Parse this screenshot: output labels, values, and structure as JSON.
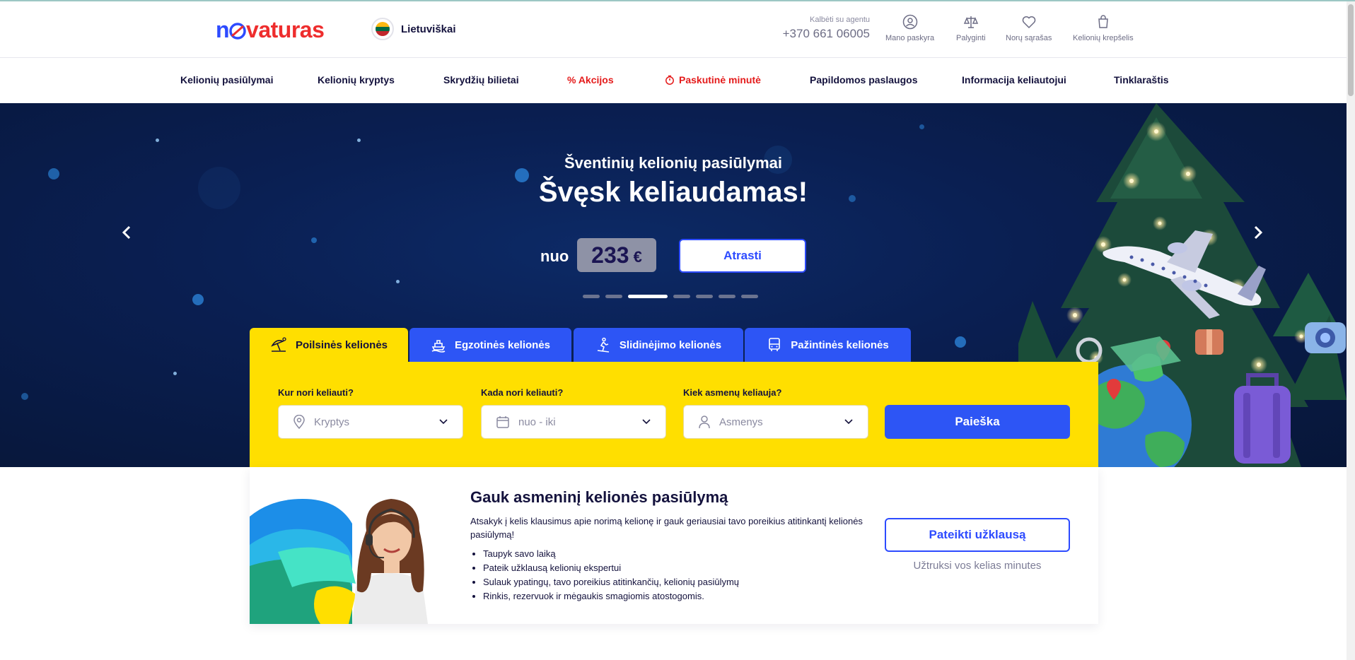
{
  "header": {
    "logo_part1": "n",
    "logo_part2": "va",
    "logo_part3": "turas",
    "language": "Lietuviškai",
    "agent_label": "Kalbėti su agentu",
    "agent_phone": "+370 661 06005",
    "account": "Mano paskyra",
    "compare": "Palyginti",
    "wishlist": "Norų sąrašas",
    "cart": "Kelionių krepšelis"
  },
  "nav": {
    "items": [
      "Kelionių pasiūlymai",
      "Kelionių kryptys",
      "Skrydžių bilietai",
      "% Akcijos",
      "Paskutinė minutė",
      "Papildomos paslaugos",
      "Informacija keliautojui",
      "Tinklaraštis"
    ]
  },
  "hero": {
    "subtitle": "Šventinių kelionių pasiūlymai",
    "title": "Švęsk keliaudamas!",
    "from_label": "nuo",
    "price": "233",
    "currency": "€",
    "cta": "Atrasti",
    "slide_count": 7,
    "active_slide": 3
  },
  "tabs": [
    "Poilsinės kelionės",
    "Egzotinės kelionės",
    "Slidinėjimo kelionės",
    "Pažintinės kelionės"
  ],
  "search": {
    "where_label": "Kur nori keliauti?",
    "where_placeholder": "Kryptys",
    "when_label": "Kada nori keliauti?",
    "when_placeholder": "nuo - iki",
    "who_label": "Kiek asmenų keliauja?",
    "who_placeholder": "Asmenys",
    "button": "Paieška"
  },
  "offer": {
    "title": "Gauk asmeninį kelionės pasiūlymą",
    "description": "Atsakyk į kelis klausimus apie norimą kelionę ir gauk geriausiai tavo poreikius atitinkantį kelionės pasiūlymą!",
    "bullets": [
      "Taupyk savo laiką",
      "Pateik užklausą kelionių ekspertui",
      "Sulauk ypatingų, tavo poreikius atitinkančių, kelionių pasiūlymų",
      "Rinkis, rezervuok ir mėgaukis smagiomis atostogomis."
    ],
    "button": "Pateikti užklausą",
    "note": "Užtruksi vos kelias minutes"
  },
  "colors": {
    "brand_blue": "#2d4bff",
    "brand_red": "#ee2d2d",
    "accent_yellow": "#ffdf00",
    "hero_bg": "#0a1f52"
  }
}
